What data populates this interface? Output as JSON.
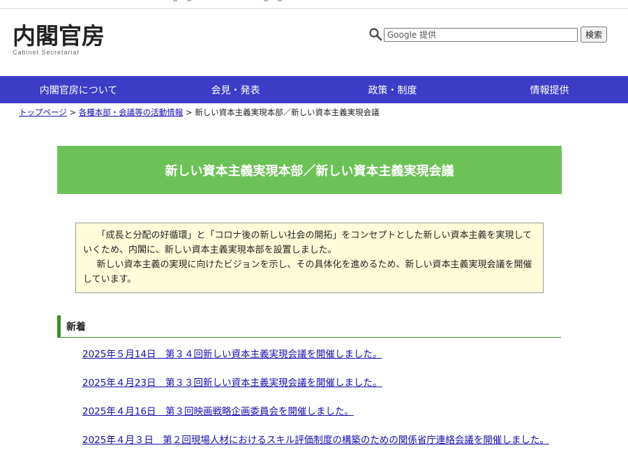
{
  "header": {
    "logo_jp": "内閣官房",
    "logo_en": "Cabinet Secretariat"
  },
  "search": {
    "placeholder": "Google 提供",
    "button_label": "検索"
  },
  "nav": {
    "items": [
      {
        "label": "内閣官房について"
      },
      {
        "label": "会見・発表"
      },
      {
        "label": "政策・制度"
      },
      {
        "label": "情報提供"
      }
    ]
  },
  "breadcrumb": {
    "home": "トップページ",
    "sep1": " > ",
    "section": "各種本部・会議等の活動情報",
    "sep2": " > ",
    "current": "新しい資本主義実現本部／新しい資本主義実現会議"
  },
  "page": {
    "title": "新しい資本主義実現本部／新しい資本主義実現会議",
    "intro_p1": "「成長と分配の好循環」と「コロナ後の新しい社会の開拓」をコンセプトとした新しい資本主義を実現していくため、内閣に、新しい資本主義実現本部を設置しました。",
    "intro_p2": "新しい資本主義の実現に向けたビジョンを示し、その具体化を進めるため、新しい資本主義実現会議を開催しています。"
  },
  "news": {
    "heading": "新着",
    "items": [
      {
        "text": "2025年５月14日　第３４回新しい資本主義実現会議を開催しました。"
      },
      {
        "text": "2025年４月23日　第３３回新しい資本主義実現会議を開催しました。"
      },
      {
        "text": "2025年４月16日　第３回映画戦略企画委員会を開催しました。"
      },
      {
        "text": "2025年４月３日　第２回現場人材におけるスキル評価制度の構築のための関係省庁連絡会議を開催しました。"
      }
    ]
  },
  "colors": {
    "nav_bg": "#3b3dc6",
    "banner_bg": "#6cc257",
    "intro_bg": "#fffdd9",
    "section_accent": "#3e8e2a",
    "link": "#1a0dab"
  }
}
